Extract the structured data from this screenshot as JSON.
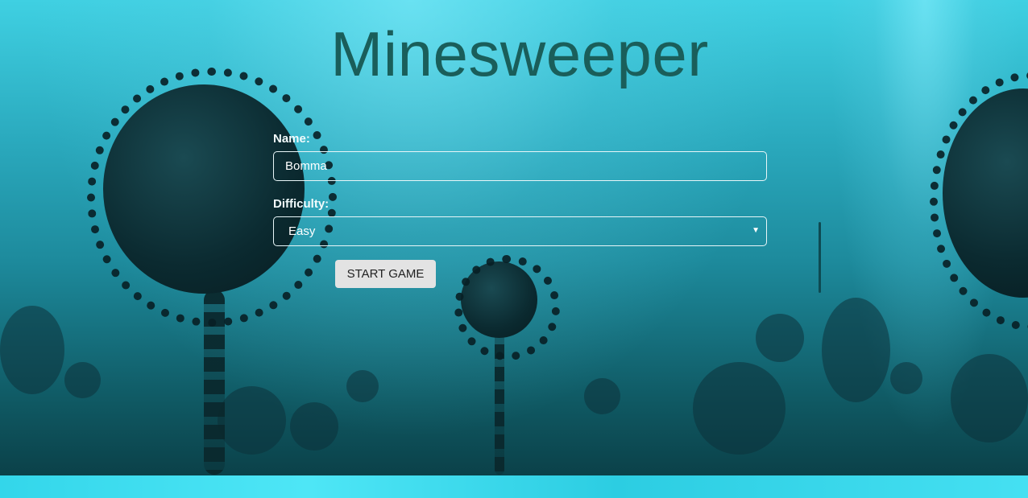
{
  "app": {
    "title": "Minesweeper"
  },
  "form": {
    "name_label": "Name:",
    "name_value": "Bomma",
    "difficulty_label": "Difficulty:",
    "difficulty_selected": "Easy",
    "start_button_label": "START GAME"
  },
  "theme": {
    "title_color": "#1a5e5a",
    "background_color": "#1fb6c8",
    "button_color": "#e3e3e3"
  }
}
